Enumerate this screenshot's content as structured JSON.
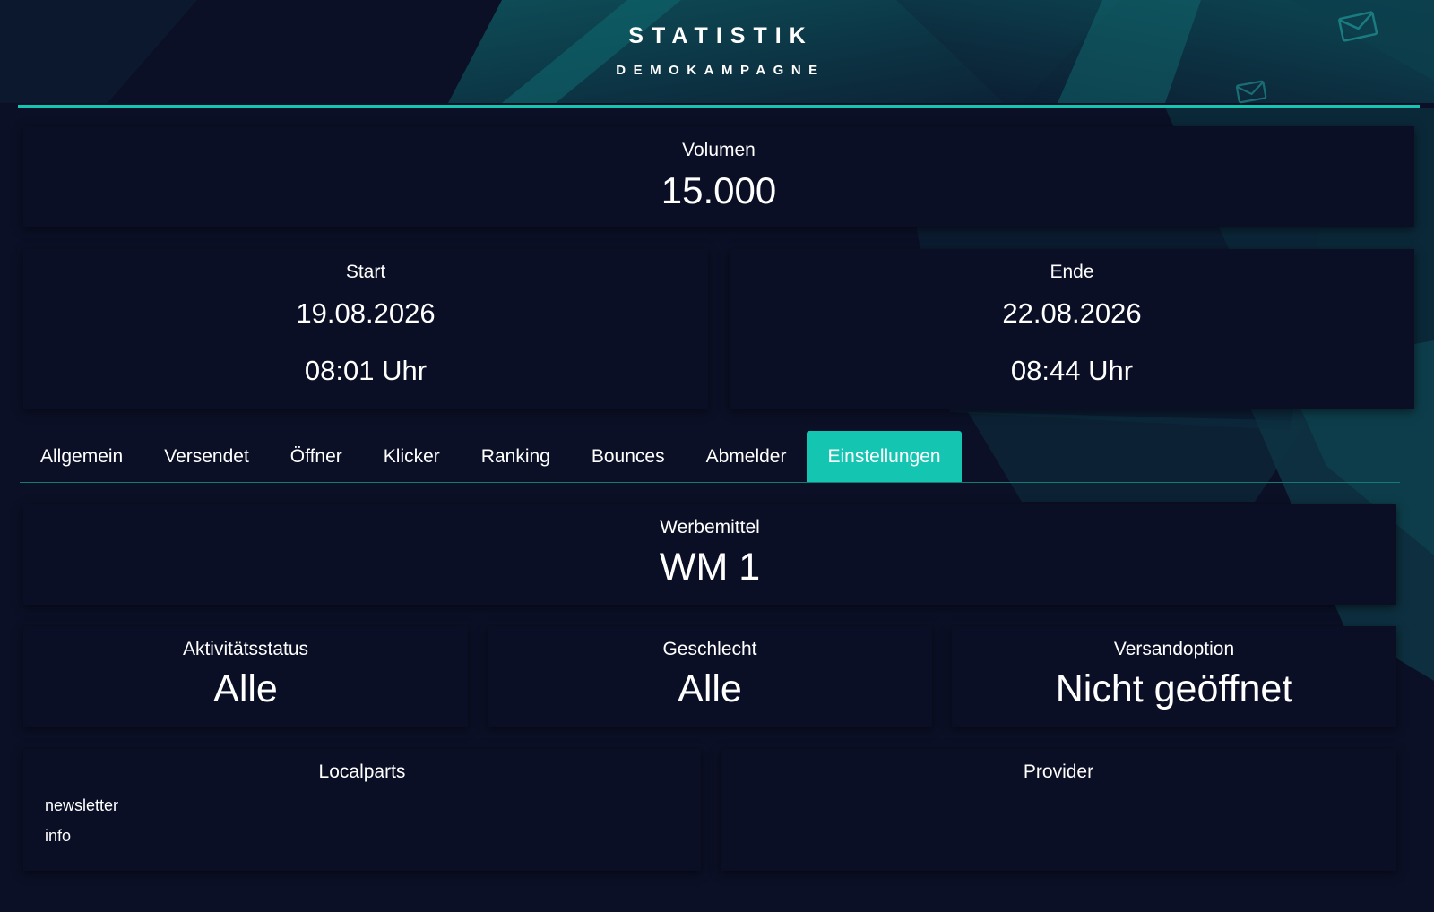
{
  "header": {
    "title": "STATISTIK",
    "subtitle": "DEMOKAMPAGNE"
  },
  "colors": {
    "accent": "#14c6b2",
    "background": "#0b1026",
    "card": "#0a0f25"
  },
  "volume": {
    "label": "Volumen",
    "value": "15.000"
  },
  "start": {
    "label": "Start",
    "date": "19.08.2026",
    "time": "08:01 Uhr"
  },
  "end": {
    "label": "Ende",
    "date": "22.08.2026",
    "time": "08:44 Uhr"
  },
  "tabs": [
    {
      "label": "Allgemein",
      "active": false
    },
    {
      "label": "Versendet",
      "active": false
    },
    {
      "label": "Öffner",
      "active": false
    },
    {
      "label": "Klicker",
      "active": false
    },
    {
      "label": "Ranking",
      "active": false
    },
    {
      "label": "Bounces",
      "active": false
    },
    {
      "label": "Abmelder",
      "active": false
    },
    {
      "label": "Einstellungen",
      "active": true
    }
  ],
  "settings": {
    "werbemittel": {
      "label": "Werbemittel",
      "value": "WM 1"
    },
    "aktivitaetsstatus": {
      "label": "Aktivitätsstatus",
      "value": "Alle"
    },
    "geschlecht": {
      "label": "Geschlecht",
      "value": "Alle"
    },
    "versandoption": {
      "label": "Versandoption",
      "value": "Nicht geöffnet"
    },
    "localparts": {
      "label": "Localparts",
      "items": [
        "newsletter",
        "info"
      ]
    },
    "provider": {
      "label": "Provider",
      "items": []
    }
  },
  "icons": [
    "mail-icon"
  ]
}
